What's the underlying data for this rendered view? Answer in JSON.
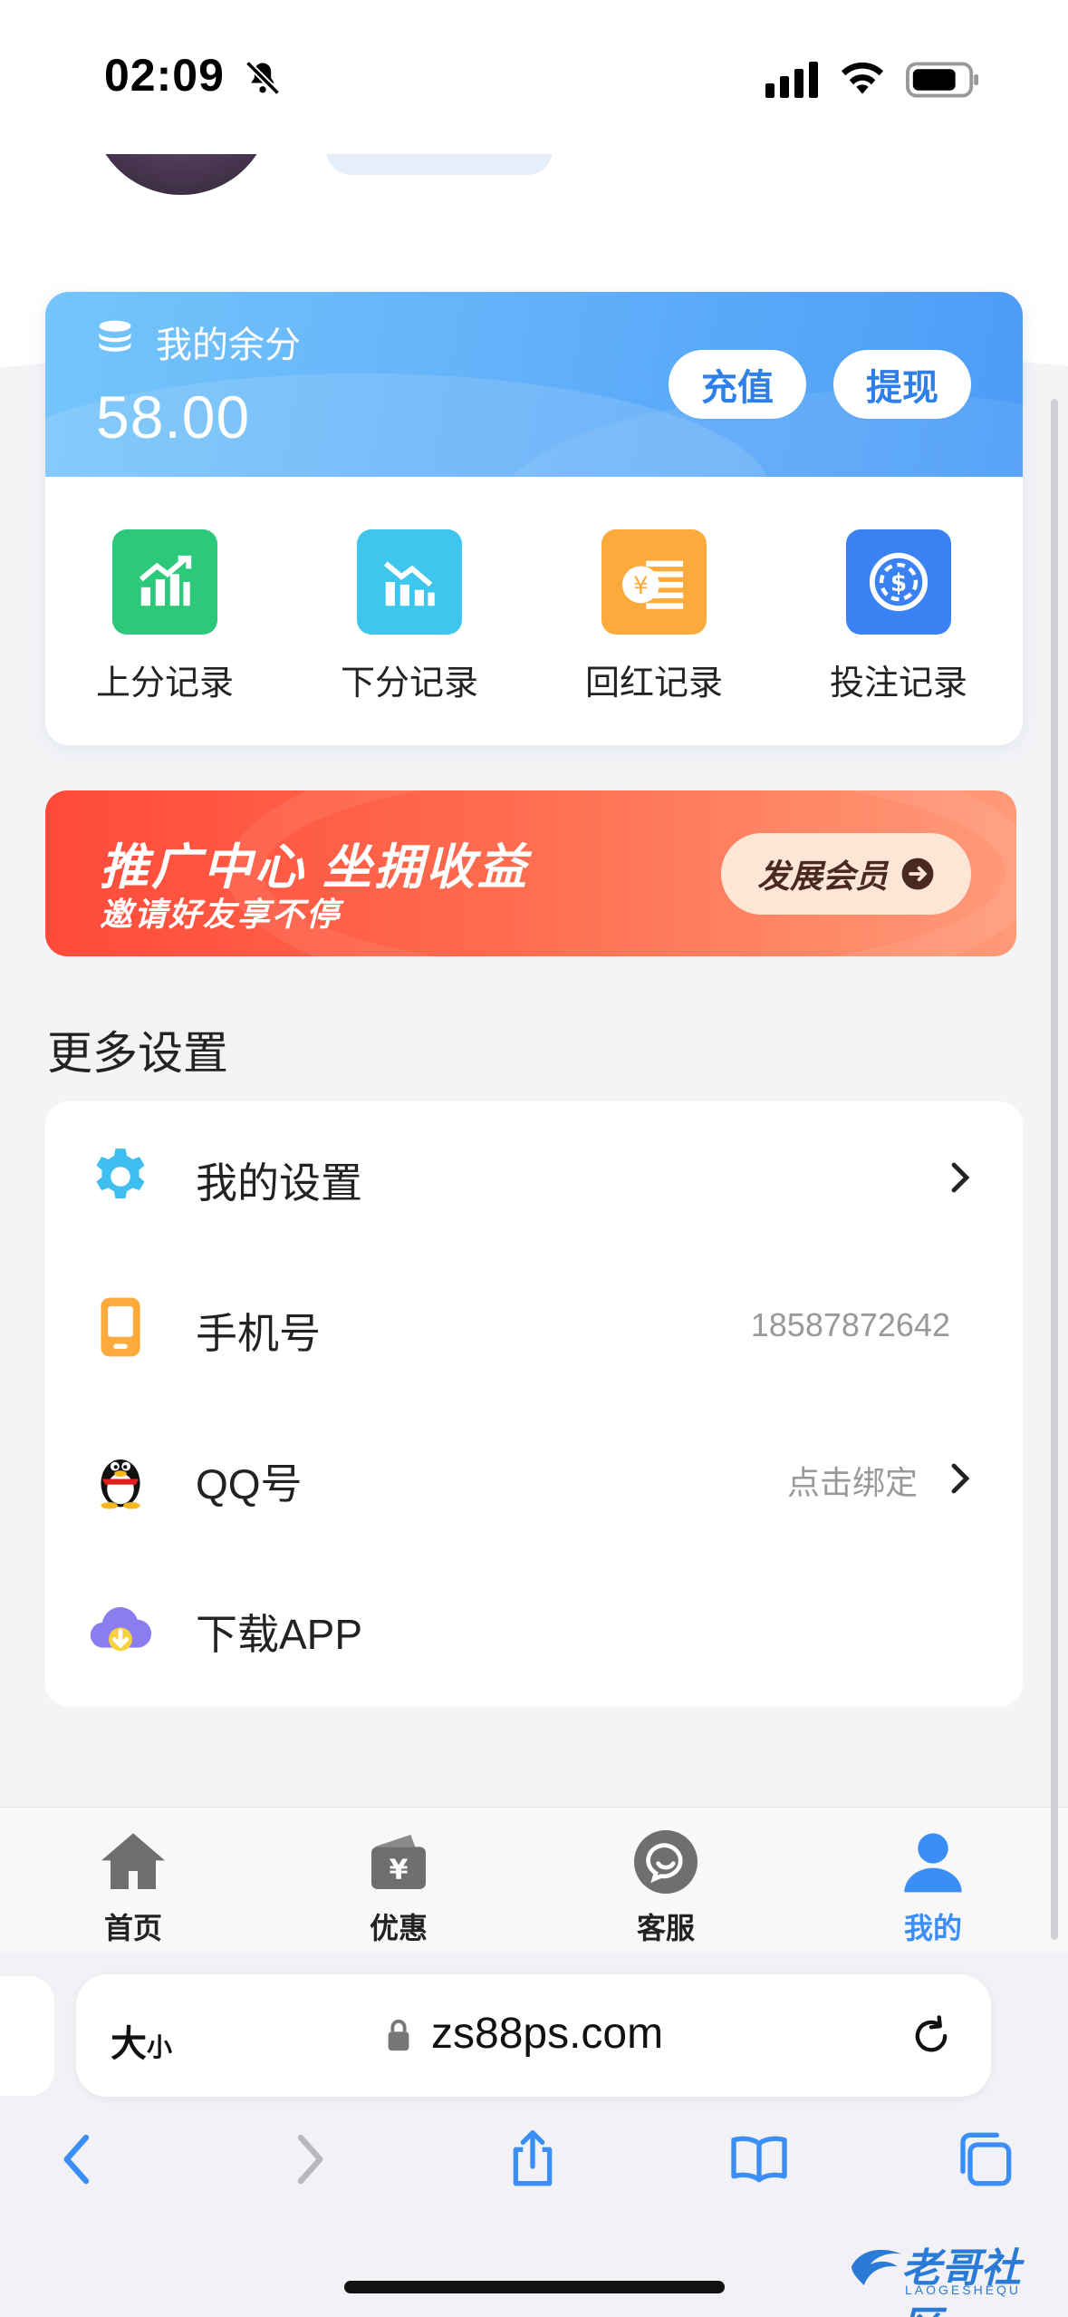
{
  "status_bar": {
    "time": "02:09"
  },
  "balance": {
    "label": "我的余分",
    "value": "58.00",
    "recharge_label": "充值",
    "withdraw_label": "提现"
  },
  "records": [
    {
      "label": "上分记录",
      "icon": "chart-up-icon",
      "color": "#2cc97a"
    },
    {
      "label": "下分记录",
      "icon": "chart-down-icon",
      "color": "#3fc6ec"
    },
    {
      "label": "回红记录",
      "icon": "yuan-coin-icon",
      "color": "#fbaa3b"
    },
    {
      "label": "投注记录",
      "icon": "bet-chip-icon",
      "color": "#3a82f3"
    }
  ],
  "promo": {
    "title": "推广中心 坐拥收益",
    "subtitle": "邀请好友享不停",
    "button_label": "发展会员"
  },
  "settings": {
    "title": "更多设置",
    "rows": [
      {
        "label": "我的设置",
        "value": "",
        "icon": "gear-icon"
      },
      {
        "label": "手机号",
        "value": "18587872642",
        "icon": "phone-icon"
      },
      {
        "label": "QQ号",
        "value": "点击绑定",
        "icon": "qq-penguin-icon"
      },
      {
        "label": "下载APP",
        "value": "",
        "icon": "cloud-download-icon"
      }
    ]
  },
  "tabs": [
    {
      "label": "首页",
      "icon": "home-icon"
    },
    {
      "label": "优惠",
      "icon": "wallet-yuan-icon"
    },
    {
      "label": "客服",
      "icon": "chat-icon"
    },
    {
      "label": "我的",
      "icon": "user-icon",
      "active": true
    }
  ],
  "browser": {
    "text_size_big": "大",
    "text_size_small": "小",
    "url": "zs88ps.com"
  },
  "watermark": {
    "text": "老哥社区",
    "sub": "LAOGESHEQU"
  },
  "colors": {
    "accent": "#3a8ef6",
    "promo": "#ff5a45"
  }
}
